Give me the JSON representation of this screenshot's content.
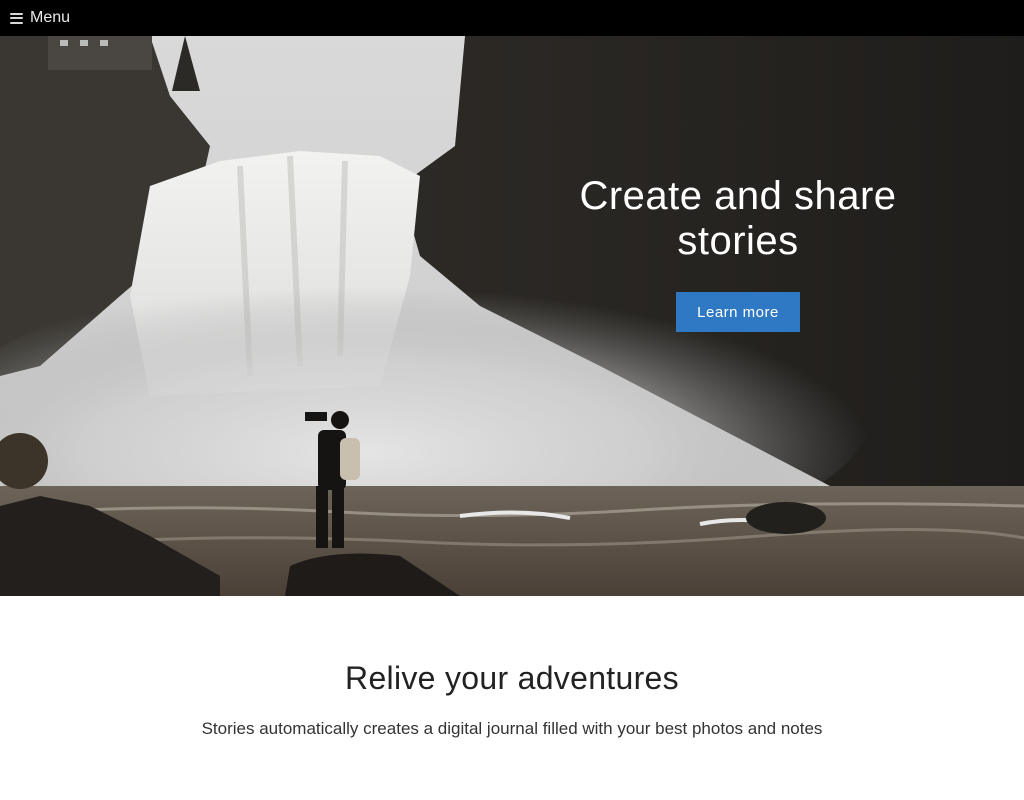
{
  "nav": {
    "menu_label": "Menu"
  },
  "hero": {
    "title": "Create and share stories",
    "cta_label": "Learn more"
  },
  "section": {
    "title": "Relive your adventures",
    "subtitle": "Stories automatically creates a digital journal filled with your best photos and notes"
  },
  "colors": {
    "nav_bg": "#000000",
    "cta_bg": "#2f78c4",
    "page_bg": "#ffffff"
  }
}
